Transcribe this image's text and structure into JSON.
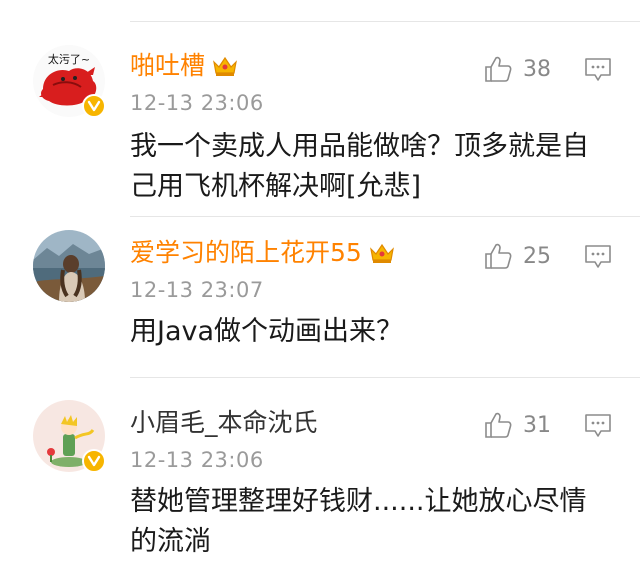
{
  "comments": [
    {
      "username": "啪吐槽",
      "vip": true,
      "timestamp": "12-13 23:06",
      "likes": "38",
      "text": "我一个卖成人用品能做啥？顶多就是自己用飞机杯解决啊[允悲]",
      "avatar_text": "太污了~",
      "avatar_icon": "red-creature-avatar",
      "verified": true
    },
    {
      "username": "爱学习的陌上花开55",
      "vip": true,
      "timestamp": "12-13 23:07",
      "likes": "25",
      "text": "用Java做个动画出来？",
      "avatar_icon": "girl-by-lake-avatar",
      "verified": false
    },
    {
      "username": "小眉毛_本命沈氏",
      "vip": false,
      "timestamp": "12-13 23:06",
      "likes": "31",
      "text": "替她管理整理好钱财......让她放心尽情的流淌",
      "avatar_icon": "little-prince-avatar",
      "verified": true
    }
  ],
  "colors": {
    "vip_name": "#ff8200",
    "normal_name": "#333333",
    "timestamp": "#9a9a9a",
    "verified_badge": "#f7b500",
    "divider": "#e6e6e6"
  },
  "icons": {
    "like": "thumbs-up-icon",
    "reply": "comment-icon",
    "crown": "vip-crown-icon",
    "verified": "verified-v-icon"
  }
}
